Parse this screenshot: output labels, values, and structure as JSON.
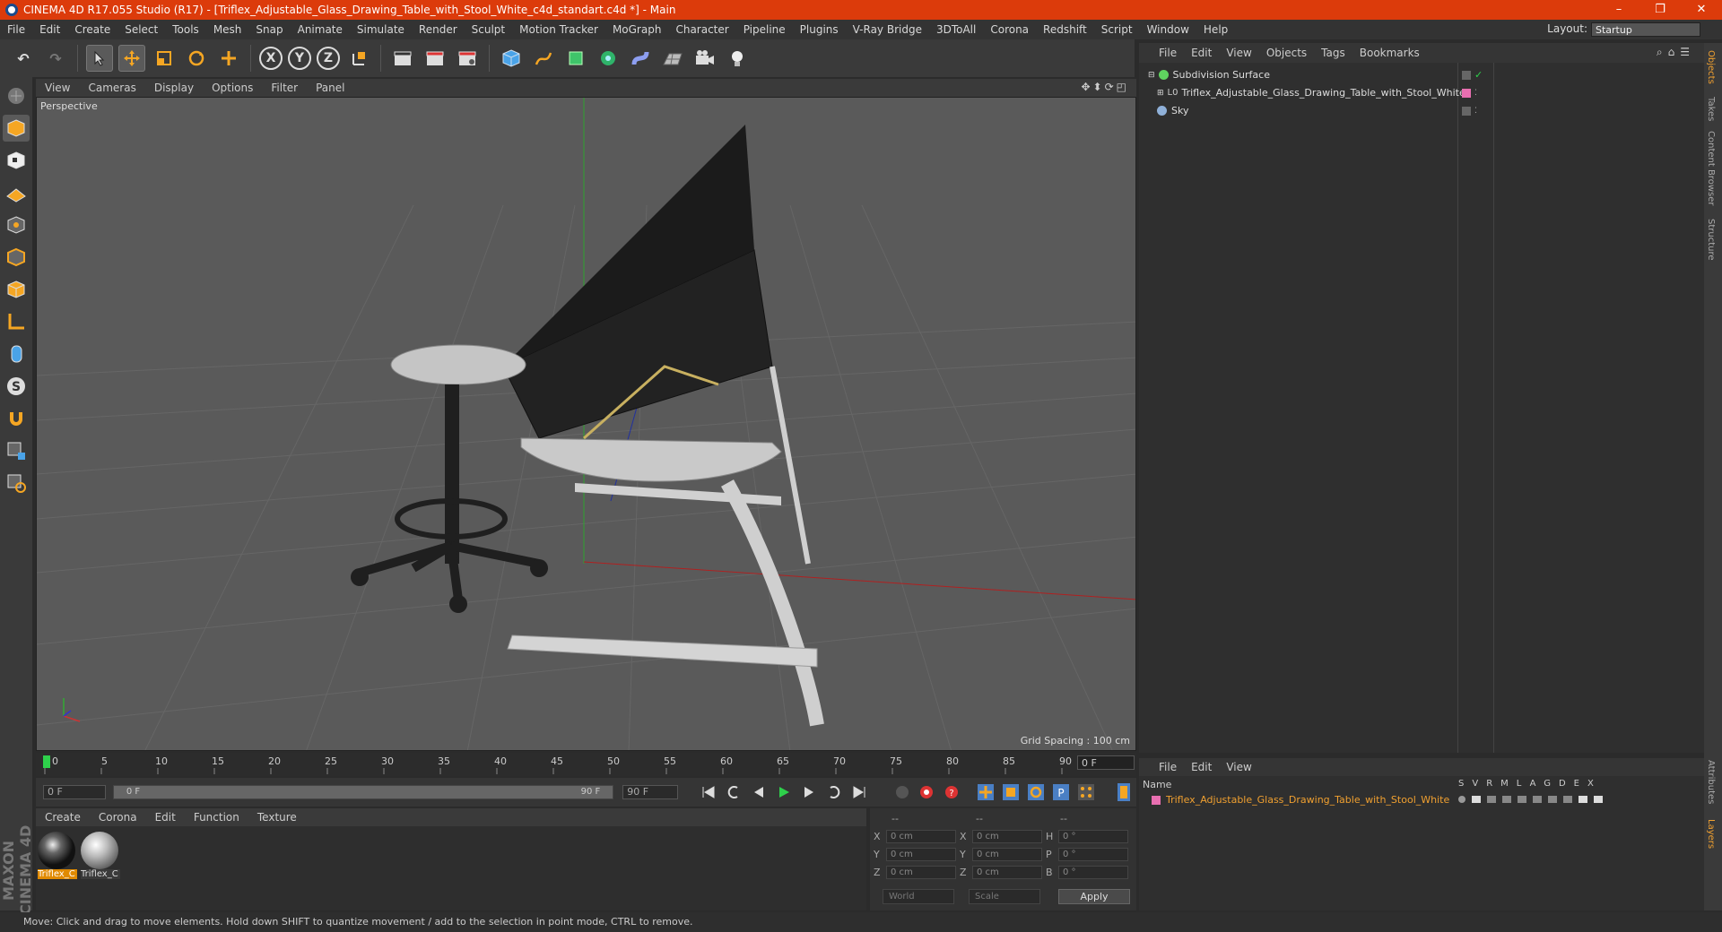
{
  "window": {
    "title": "CINEMA 4D R17.055 Studio (R17) - [Triflex_Adjustable_Glass_Drawing_Table_with_Stool_White_c4d_standart.c4d *] - Main",
    "minimize": "–",
    "restore": "❐",
    "close": "✕"
  },
  "menubar": {
    "items": [
      "File",
      "Edit",
      "Create",
      "Select",
      "Tools",
      "Mesh",
      "Snap",
      "Animate",
      "Simulate",
      "Render",
      "Sculpt",
      "Motion Tracker",
      "MoGraph",
      "Character",
      "Pipeline",
      "Plugins",
      "V-Ray Bridge",
      "3DToAll",
      "Corona",
      "Redshift",
      "Script",
      "Window",
      "Help"
    ],
    "layout_label": "Layout:",
    "layout_value": "Startup"
  },
  "toolbar": {
    "undo": "↶",
    "redo": "↷",
    "axis_x": "X",
    "axis_y": "Y",
    "axis_z": "Z"
  },
  "viewport": {
    "menu": [
      "View",
      "Cameras",
      "Display",
      "Options",
      "Filter",
      "Panel"
    ],
    "nav_icons": "✥⬍⟳◰",
    "camera_label": "Perspective",
    "grid_spacing": "Grid Spacing : 100 cm"
  },
  "timeline": {
    "ticks": [
      "0",
      "5",
      "10",
      "15",
      "20",
      "25",
      "30",
      "35",
      "40",
      "45",
      "50",
      "55",
      "60",
      "65",
      "70",
      "75",
      "80",
      "85",
      "90"
    ],
    "current_frame": "0 F",
    "start_field": "0 F",
    "range_start": "0 F",
    "range_end": "90 F",
    "end_field": "90 F"
  },
  "material_manager": {
    "menu": [
      "Create",
      "Corona",
      "Edit",
      "Function",
      "Texture"
    ],
    "materials": [
      {
        "label": "Triflex_C"
      },
      {
        "label": "Triflex_C"
      }
    ]
  },
  "coordinates": {
    "headers": [
      "--",
      "--",
      "--"
    ],
    "rows": [
      {
        "a": "X",
        "av": "0 cm",
        "b": "X",
        "bv": "0 cm",
        "c": "H",
        "cv": "0 °"
      },
      {
        "a": "Y",
        "av": "0 cm",
        "b": "Y",
        "bv": "0 cm",
        "c": "P",
        "cv": "0 °"
      },
      {
        "a": "Z",
        "av": "0 cm",
        "b": "Z",
        "bv": "0 cm",
        "c": "B",
        "cv": "0 °"
      }
    ],
    "world": "World",
    "scale": "Scale",
    "apply": "Apply"
  },
  "object_manager": {
    "menu": [
      "File",
      "Edit",
      "View",
      "Objects",
      "Tags",
      "Bookmarks"
    ],
    "icons": "⌕⌂☰",
    "objects": [
      {
        "name": "Subdivision Surface",
        "color": "#5fd35f"
      },
      {
        "name": "Triflex_Adjustable_Glass_Drawing_Table_with_Stool_White",
        "color": "#aaaaaa"
      },
      {
        "name": "Sky",
        "color": "#8fb0d8"
      }
    ]
  },
  "layer_manager": {
    "menu": [
      "File",
      "Edit",
      "View"
    ],
    "name_header": "Name",
    "columns": "SVRMLAGDEX",
    "layer_name": "Triflex_Adjustable_Glass_Drawing_Table_with_Stool_White"
  },
  "side_tabs": [
    "Objects",
    "Takes",
    "Content Browser",
    "Structure",
    "Attributes",
    "Layers"
  ],
  "status": "Move: Click and drag to move elements. Hold down SHIFT to quantize movement / add to the selection in point mode, CTRL to remove.",
  "brand": "MAXON CINEMA 4D"
}
